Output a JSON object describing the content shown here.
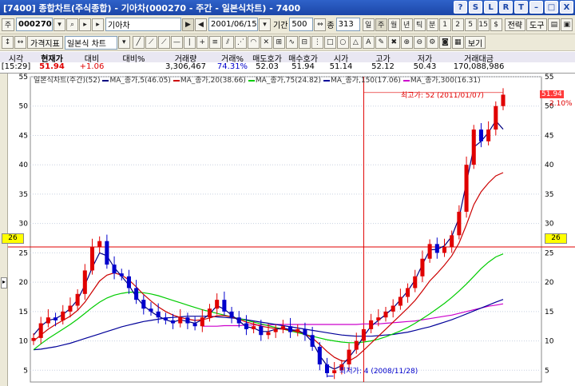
{
  "window": {
    "title": "[7400] 종합차트(주식종합) - 기아차(000270 - 주간 - 일본식차트) - 7400",
    "buttons": [
      "?",
      "S",
      "L",
      "R",
      "T",
      "–",
      "□",
      "X"
    ]
  },
  "toolbar1": {
    "prefix": "주",
    "code": "000270",
    "stock_name": "기아차",
    "date": "2001/06/15",
    "period_label": "기간",
    "period_value": "500",
    "count_label": "종",
    "count_value": "313",
    "periods": [
      "일",
      "주",
      "월",
      "년",
      "틱",
      "분",
      "1",
      "2",
      "5",
      "15",
      "$"
    ],
    "strategy": "전략",
    "tools": "도구",
    "save": "[저장]"
  },
  "toolbar2": {
    "indicator_label": "가격지표",
    "chart_type": "일본식 차트",
    "view": "보기"
  },
  "quote": {
    "headers": [
      "시각",
      "현재가",
      "대비",
      "대비%",
      "거래량",
      "거래%",
      "매도호가",
      "매수호가",
      "시가",
      "고가",
      "저가",
      "거래대금"
    ],
    "values": [
      "[15:29]",
      "51.94",
      "+1.06",
      "",
      "3,306,467",
      "74.31%",
      "52.03",
      "51.94",
      "51.14",
      "52.12",
      "50.43",
      "170,088,986"
    ]
  },
  "legend": {
    "series": [
      {
        "label": "일본식차트(주간)(52)",
        "color": "#000000"
      },
      {
        "label": "MA_종가,5(46.05)",
        "color": "#000080"
      },
      {
        "label": "MA_종가,20(38.66)",
        "color": "#cc0000"
      },
      {
        "label": "MA_종가,75(24.82)",
        "color": "#00cc00"
      },
      {
        "label": "MA_종가,150(17.06)",
        "color": "#000099"
      },
      {
        "label": "MA_종가,300(16.31)",
        "color": "#cc00cc"
      }
    ]
  },
  "annotations": {
    "high": "최고가: 52 (2011/01/07)",
    "low": "최저가: 4 (2008/11/28)",
    "last_price": "51.94",
    "last_pct": "2.10%",
    "crosshair_value": "26"
  },
  "chart_data": {
    "type": "candlestick",
    "ylim": [
      3,
      55
    ],
    "y_ticks": [
      5,
      10,
      15,
      20,
      25,
      30,
      35,
      40,
      45,
      50,
      55
    ],
    "crosshair_y": 26,
    "close_series": [
      10.5,
      13,
      14,
      13.5,
      15,
      16,
      18,
      22,
      26,
      27,
      23,
      21.5,
      21,
      19,
      17,
      15.5,
      15,
      14,
      13.5,
      13,
      14,
      13,
      12.5,
      14,
      15.5,
      17,
      15,
      14,
      13,
      12,
      12.5,
      11,
      11.5,
      12,
      12.5,
      11.5,
      12,
      11,
      9,
      6,
      4.5,
      5,
      6,
      8.5,
      10,
      12,
      13.5,
      14,
      15,
      16,
      17.5,
      19,
      21,
      24,
      26.5,
      25,
      26,
      28,
      32,
      40,
      46,
      44,
      46,
      50,
      51.94
    ],
    "ma5": [
      11,
      12.5,
      13.5,
      13.8,
      14.5,
      15.5,
      17,
      19.5,
      22.5,
      25,
      24.5,
      22.5,
      21,
      19.5,
      17.5,
      16,
      15,
      14.2,
      13.6,
      13.2,
      13.6,
      13.3,
      13,
      13.6,
      14.6,
      16,
      15.4,
      14.4,
      13.4,
      12.4,
      12.2,
      11.6,
      11.6,
      12,
      12.2,
      11.9,
      11.8,
      11.2,
      9.8,
      7.5,
      5.8,
      5.2,
      5.8,
      7.2,
      8.8,
      10.8,
      12.5,
      13.5,
      14.5,
      15.6,
      17,
      18.5,
      20.4,
      23,
      25.5,
      25.6,
      26.2,
      27.8,
      31,
      37,
      43,
      44,
      45.5,
      47.5,
      46.05
    ],
    "ma20": [
      10,
      11,
      12,
      12.8,
      13.5,
      14.2,
      15.2,
      16.6,
      18.4,
      20.2,
      21.2,
      21.6,
      21.2,
      20.4,
      19.2,
      17.9,
      16.8,
      15.8,
      15,
      14.4,
      14,
      13.7,
      13.5,
      13.6,
      13.9,
      14.3,
      14.3,
      14.1,
      13.7,
      13.2,
      12.9,
      12.5,
      12.3,
      12.1,
      12,
      11.8,
      11.6,
      11.2,
      10.5,
      9.4,
      8.2,
      7.2,
      6.6,
      6.6,
      7.3,
      8.4,
      9.6,
      10.8,
      12,
      13.2,
      14.4,
      15.6,
      16.9,
      18.5,
      20.2,
      21.5,
      22.9,
      24.5,
      26.7,
      29.8,
      33.2,
      35.4,
      36.9,
      38.1,
      38.66
    ],
    "ma75": [
      8.5,
      9.5,
      10.4,
      11.2,
      12,
      12.8,
      13.7,
      14.7,
      15.7,
      16.6,
      17.3,
      17.8,
      18.1,
      18.3,
      18.3,
      18.2,
      18,
      17.7,
      17.3,
      16.9,
      16.5,
      16.1,
      15.7,
      15.3,
      15,
      14.7,
      14.4,
      14.1,
      13.8,
      13.5,
      13.2,
      12.9,
      12.6,
      12.3,
      12,
      11.7,
      11.4,
      11.1,
      10.8,
      10.5,
      10.2,
      10,
      9.8,
      9.7,
      9.7,
      9.8,
      10,
      10.3,
      10.7,
      11.2,
      11.7,
      12.3,
      13,
      13.8,
      14.6,
      15.5,
      16.4,
      17.4,
      18.5,
      19.7,
      21,
      22.3,
      23.4,
      24.3,
      24.82
    ],
    "ma150": [
      8.5,
      8.6,
      8.8,
      9,
      9.3,
      9.6,
      10,
      10.4,
      10.8,
      11.2,
      11.6,
      12,
      12.4,
      12.7,
      13,
      13.3,
      13.5,
      13.7,
      13.9,
      14,
      14.1,
      14.2,
      14.2,
      14.2,
      14.2,
      14.1,
      14,
      13.9,
      13.8,
      13.6,
      13.4,
      13.2,
      13,
      12.8,
      12.6,
      12.4,
      12.2,
      12,
      11.8,
      11.6,
      11.4,
      11.2,
      11,
      10.9,
      10.8,
      10.8,
      10.8,
      10.9,
      11,
      11.1,
      11.3,
      11.5,
      11.8,
      12.1,
      12.4,
      12.8,
      13.2,
      13.6,
      14.1,
      14.6,
      15.1,
      15.6,
      16.1,
      16.6,
      17.06
    ],
    "ma300": [
      null,
      null,
      null,
      null,
      null,
      null,
      null,
      null,
      null,
      null,
      null,
      null,
      null,
      null,
      null,
      null,
      null,
      null,
      null,
      null,
      null,
      null,
      null,
      12.5,
      12.5,
      12.5,
      12.6,
      12.6,
      12.6,
      12.7,
      12.7,
      12.7,
      12.7,
      12.8,
      12.8,
      12.8,
      12.8,
      12.8,
      12.8,
      12.8,
      12.8,
      12.8,
      12.8,
      12.8,
      12.8,
      12.9,
      12.9,
      12.9,
      13,
      13.1,
      13.2,
      13.3,
      13.4,
      13.6,
      13.8,
      14,
      14.2,
      14.4,
      14.7,
      15,
      15.3,
      15.6,
      15.9,
      16.1,
      16.31
    ]
  },
  "colors": {
    "title_bg": "#1b46a8",
    "up": "#e00000",
    "down": "#0000cc",
    "crosshair": "#e00000",
    "grid": "#c8d0e0",
    "highlight": "#ffff00"
  }
}
